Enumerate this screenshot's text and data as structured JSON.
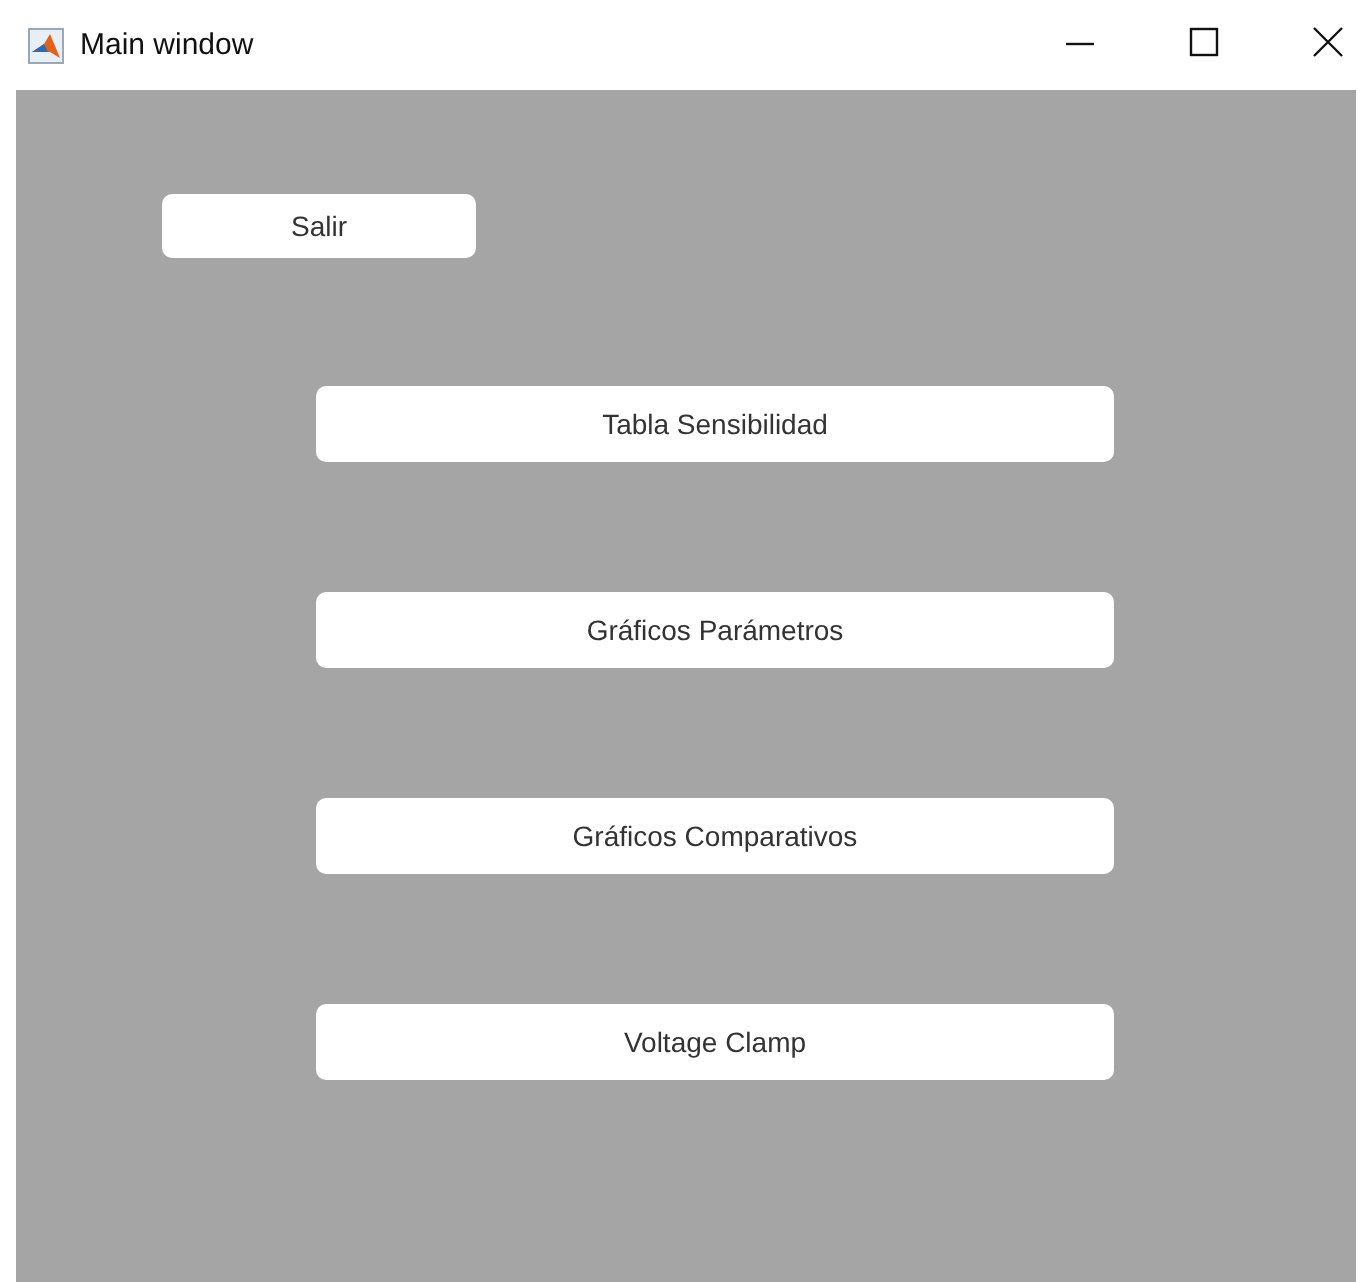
{
  "window": {
    "title": "Main window"
  },
  "exit_button": {
    "label": "Salir"
  },
  "buttons": [
    {
      "label": "Tabla Sensibilidad"
    },
    {
      "label": "Gráficos Parámetros"
    },
    {
      "label": "Gráficos Comparativos"
    },
    {
      "label": "Voltage Clamp"
    }
  ]
}
